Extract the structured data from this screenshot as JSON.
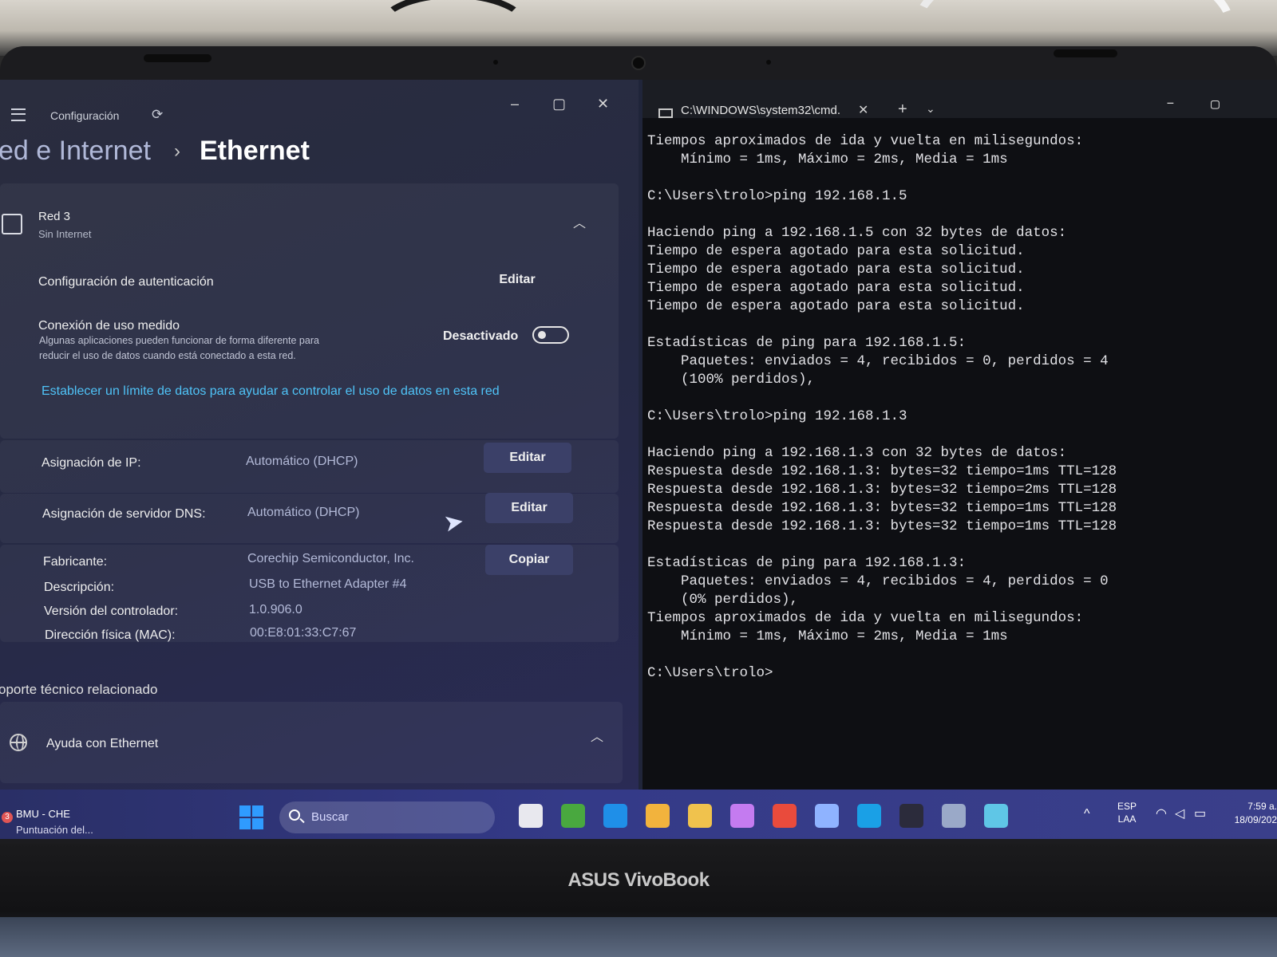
{
  "device": {
    "brand": "ASUS VivoBook"
  },
  "settings": {
    "window_title": "Configuración",
    "window_controls": {
      "minimize": "–",
      "maximize": "▢",
      "close": "✕"
    },
    "breadcrumb": {
      "parent": "ed e Internet",
      "separator": "›",
      "current": "Ethernet"
    },
    "network": {
      "name": "Red 3",
      "status": "Sin Internet"
    },
    "auth": {
      "label": "Configuración de autenticación",
      "button": "Editar"
    },
    "metered": {
      "label": "Conexión de uso medido",
      "description_1": "Algunas aplicaciones pueden funcionar de forma diferente para",
      "description_2": "reducir el uso de datos cuando está conectado a esta red.",
      "toggle_label": "Desactivado",
      "toggle_on": false
    },
    "data_limit_link": "Establecer un límite de datos para ayudar a controlar el uso de datos en esta red",
    "ip": {
      "label": "Asignación de IP:",
      "value": "Automático (DHCP)",
      "button": "Editar"
    },
    "dns": {
      "label": "Asignación de servidor DNS:",
      "value": "Automático (DHCP)",
      "button": "Editar"
    },
    "info": {
      "copy_button": "Copiar",
      "rows": [
        {
          "label": "Fabricante:",
          "value": "Corechip Semiconductor, Inc."
        },
        {
          "label": "Descripción:",
          "value": "USB to Ethernet Adapter #4"
        },
        {
          "label": "Versión del controlador:",
          "value": "1.0.906.0"
        },
        {
          "label": "Dirección física (MAC):",
          "value": "00:E8:01:33:C7:67"
        }
      ]
    },
    "support_heading": "oporte técnico relacionado",
    "help": {
      "label": "Ayuda con Ethernet"
    }
  },
  "terminal": {
    "tab_title": "C:\\WINDOWS\\system32\\cmd.",
    "tab_close": "✕",
    "new_tab": "+",
    "dropdown": "⌄",
    "lines": [
      "Tiempos aproximados de ida y vuelta en milisegundos:",
      "    Mínimo = 1ms, Máximo = 2ms, Media = 1ms",
      "",
      "C:\\Users\\trolo>ping 192.168.1.5",
      "",
      "Haciendo ping a 192.168.1.5 con 32 bytes de datos:",
      "Tiempo de espera agotado para esta solicitud.",
      "Tiempo de espera agotado para esta solicitud.",
      "Tiempo de espera agotado para esta solicitud.",
      "Tiempo de espera agotado para esta solicitud.",
      "",
      "Estadísticas de ping para 192.168.1.5:",
      "    Paquetes: enviados = 4, recibidos = 0, perdidos = 4",
      "    (100% perdidos),",
      "",
      "C:\\Users\\trolo>ping 192.168.1.3",
      "",
      "Haciendo ping a 192.168.1.3 con 32 bytes de datos:",
      "Respuesta desde 192.168.1.3: bytes=32 tiempo=1ms TTL=128",
      "Respuesta desde 192.168.1.3: bytes=32 tiempo=2ms TTL=128",
      "Respuesta desde 192.168.1.3: bytes=32 tiempo=1ms TTL=128",
      "Respuesta desde 192.168.1.3: bytes=32 tiempo=1ms TTL=128",
      "",
      "Estadísticas de ping para 192.168.1.3:",
      "    Paquetes: enviados = 4, recibidos = 4, perdidos = 0",
      "    (0% perdidos),",
      "Tiempos aproximados de ida y vuelta en milisegundos:",
      "    Mínimo = 1ms, Máximo = 2ms, Media = 1ms",
      "",
      "C:\\Users\\trolo>"
    ]
  },
  "taskbar": {
    "news_badge": "3",
    "news_title": "BMU - CHE",
    "news_subtitle": "Puntuación del...",
    "search_placeholder": "Buscar",
    "apps": [
      "file-explorer-icon",
      "minecraft-icon",
      "edge-icon",
      "store-icon",
      "folder-icon",
      "copilot-icon",
      "chrome-icon",
      "network-share-icon",
      "photos-icon",
      "terminal-icon",
      "settings-icon",
      "remote-desktop-icon"
    ],
    "lang_1": "ESP",
    "lang_2": "LAA",
    "time": "7:59 a.",
    "date": "18/09/202"
  },
  "colors": {
    "accent_link": "#4fc3f7",
    "taskbar": "#343a88",
    "terminal_bg": "#0e0f13"
  }
}
